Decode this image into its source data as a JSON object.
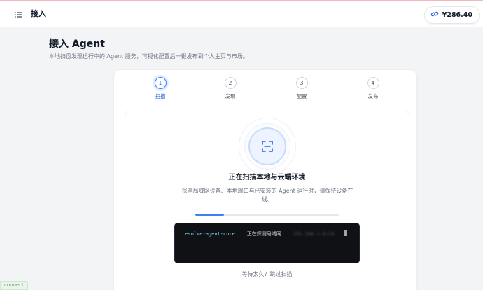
{
  "header": {
    "title": "接入",
    "balance": "¥286.40",
    "menu_icon": "list-icon",
    "balance_icon": "link-icon"
  },
  "page": {
    "title": "接入 Agent",
    "subtitle": "本地扫盘发现运行中的 Agent 服务，可视化配置后一键发布到个人主页与市场。"
  },
  "steps": [
    {
      "number": "1",
      "label": "扫描",
      "active": true
    },
    {
      "number": "2",
      "label": "发现",
      "active": false
    },
    {
      "number": "3",
      "label": "配置",
      "active": false
    },
    {
      "number": "4",
      "label": "发布",
      "active": false
    }
  ],
  "scan": {
    "icon": "scan-icon",
    "title": "正在扫描本地与云端环境",
    "description": "探测局域网设备、本地端口与已安装的 Agent 运行时，请保持设备在线。",
    "progress": 0.2
  },
  "terminal": {
    "command": "resolve-agent-core",
    "message": "正在探测局域网",
    "blurred_ip": "192.168.1.0/24",
    "trailing": "."
  },
  "skip_link": "等待太久？跳过扫描",
  "status_badge": "connect",
  "colors": {
    "accent": "#3b82f6",
    "active_step": "#2563eb",
    "terminal_bg": "#0f1115",
    "top_accent_line": "#f3b6bf"
  }
}
